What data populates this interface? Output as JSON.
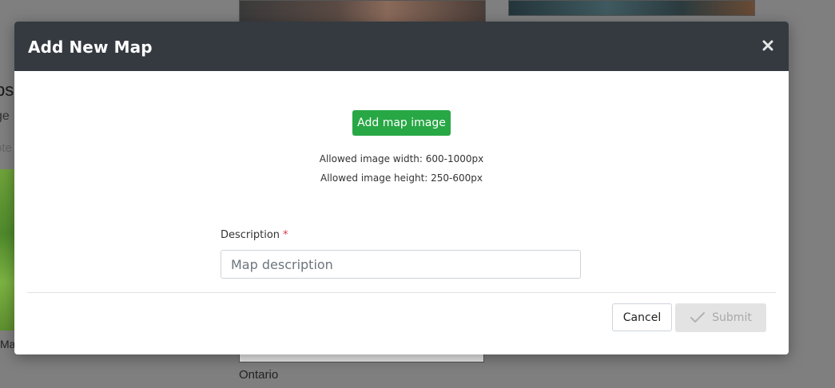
{
  "background": {
    "heading_fragment": "ps",
    "text_fragment_1": "ge",
    "text_fragment_2": "ote",
    "map_caption_fragment": "Ma",
    "photo_caption": "Ontario"
  },
  "modal": {
    "title": "Add New Map",
    "close_icon": "close-icon",
    "add_image_label": "Add map image",
    "allowed_width_text": "Allowed image width: 600-1000px",
    "allowed_height_text": "Allowed image height: 250-600px",
    "description_label": "Description",
    "required_marker": "*",
    "description_placeholder": "Map description",
    "description_value": "",
    "cancel_label": "Cancel",
    "submit_label": "Submit",
    "submit_icon": "check-icon"
  },
  "colors": {
    "header_bg": "#343a40",
    "add_button": "#28a745",
    "required": "#dc3545",
    "submit_disabled_bg": "#e3e3e3"
  }
}
